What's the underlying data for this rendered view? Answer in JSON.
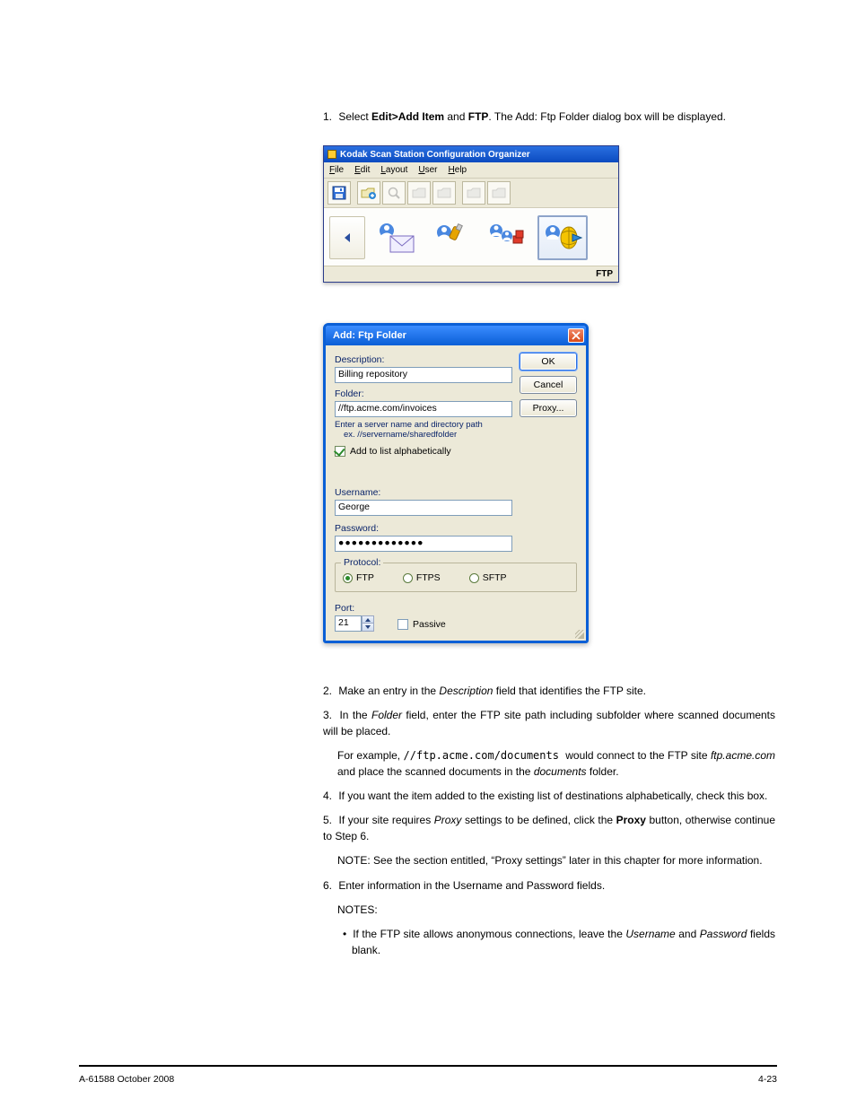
{
  "intro": {
    "step_no": "1.",
    "step_text_a": "Select ",
    "step_text_b": " and ",
    "step_text_c": ". The Add: Ftp Folder dialog box will be displayed.",
    "menu_path_a": "Edit>Add Item",
    "menu_path_b": "FTP"
  },
  "cfg": {
    "title": "Kodak Scan Station Configuration Organizer",
    "menu": {
      "file": "File",
      "edit": "Edit",
      "layout": "Layout",
      "user": "User",
      "help": "Help"
    },
    "status": "FTP"
  },
  "dlg": {
    "title": "Add:  Ftp Folder",
    "close_aria": "Close",
    "labels": {
      "description": "Description:",
      "folder": "Folder:",
      "helper_line1": "Enter a server name and directory path",
      "helper_line2": "ex. //servername/sharedfolder",
      "add_alpha": "Add to list alphabetically",
      "username": "Username:",
      "password": "Password:",
      "protocol": "Protocol:",
      "port": "Port:",
      "passive": "Passive"
    },
    "values": {
      "description": "Billing repository",
      "folder": "//ftp.acme.com/invoices",
      "username": "George",
      "password": "●●●●●●●●●●●●●",
      "port": "21"
    },
    "protocol": {
      "ftp": "FTP",
      "ftps": "FTPS",
      "sftp": "SFTP"
    },
    "buttons": {
      "ok": "OK",
      "cancel": "Cancel",
      "proxy": "Proxy..."
    }
  },
  "notes": {
    "n2": {
      "no": "2.",
      "text_a": "Make an entry in the ",
      "em_a": "Description",
      "text_b": " field that identifies the FTP site."
    },
    "n3": {
      "no": "3.",
      "text_a": "In the ",
      "em_a": "Folder",
      "text_b": " field, enter the FTP site path including subfolder where scanned documents will be placed."
    },
    "n3ex_pre": "For example, ",
    "n3ex_mono": "//ftp.acme.com/documents ",
    "n3ex_post_a": "would connect to the FTP site ",
    "n3ex_em": "ftp.acme.com",
    "n3ex_post_b": " and place the scanned documents in the ",
    "n3ex_em2": "documents",
    "n3ex_post_c": " folder.",
    "n4": {
      "no": "4.",
      "text": "If you want the item added to the existing list of destinations alphabetically, check this box."
    },
    "n5": {
      "no": "5.",
      "text_a": "If your site requires ",
      "em_a": "Proxy",
      "text_b": " settings to be defined, click the ",
      "b": "Proxy",
      "text_c": " button, otherwise continue to Step 6."
    },
    "npre": "NOTE: ",
    "ntext": "See the section entitled, “Proxy settings” later in this chapter for more information.",
    "n6a": {
      "no": "6.",
      "text": "Enter information in the Username and Password fields."
    },
    "n6b": {
      "pre": "NOTES:",
      "bul": "•",
      "text_a": "If the FTP site allows anonymous connections, leave the ",
      "em_a": "Username",
      "and": " and ",
      "em_b": "Password",
      "text_b": " fields blank."
    }
  },
  "footer": {
    "left": "A-61588  October 2008",
    "right": "4-23"
  }
}
